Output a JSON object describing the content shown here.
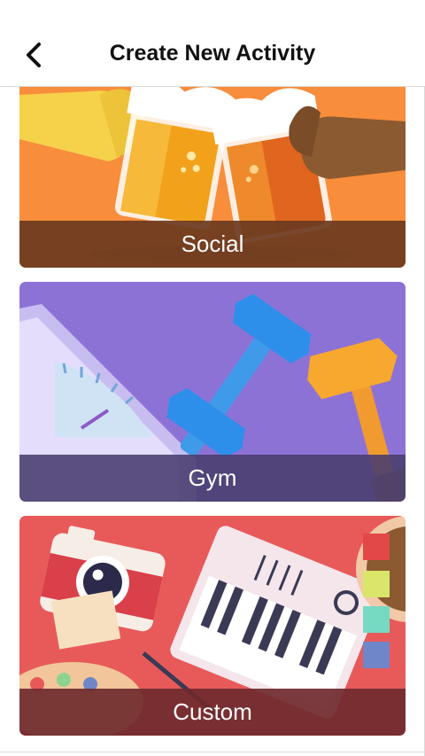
{
  "header": {
    "title": "Create New Activity",
    "back_icon": "chevron-left-icon"
  },
  "activities": [
    {
      "id": "social",
      "label": "Social",
      "bg_color": "#F88D3C",
      "bar_color": "#6B3A1F"
    },
    {
      "id": "gym",
      "label": "Gym",
      "bg_color": "#8D72D6",
      "bar_color": "#4A3F70"
    },
    {
      "id": "custom",
      "label": "Custom",
      "bg_color": "#E85A5A",
      "bar_color": "#6F2A2E"
    }
  ]
}
